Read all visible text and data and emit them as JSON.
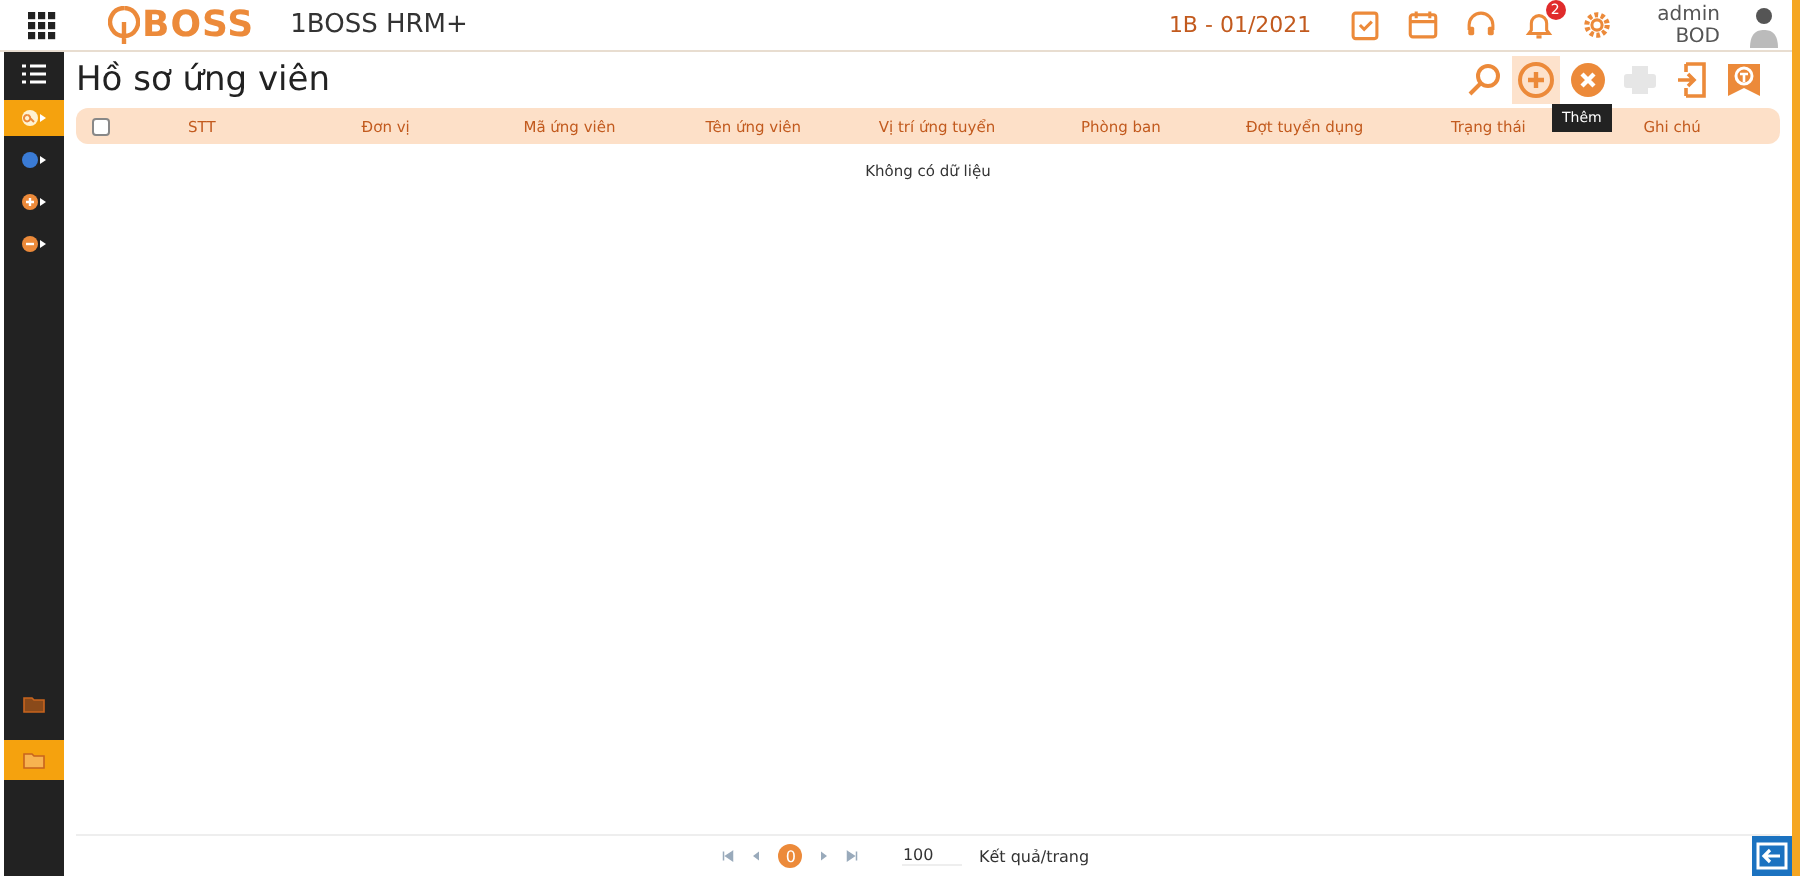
{
  "header": {
    "logo": "BOSS",
    "app_name": "1BOSS HRM+",
    "period": "1B - 01/2021",
    "notification_count": "2",
    "user": {
      "name": "admin",
      "role": "BOD"
    }
  },
  "sidebar": {
    "items": [
      {
        "kind": "search",
        "selected": true
      },
      {
        "kind": "globe",
        "selected": false
      },
      {
        "kind": "plus",
        "selected": false
      },
      {
        "kind": "minus",
        "selected": false
      }
    ],
    "bottom_items": [
      {
        "selected": false
      },
      {
        "selected": true
      }
    ]
  },
  "page": {
    "title": "Hồ sơ ứng viên"
  },
  "toolbar": [
    {
      "kind": "search",
      "disabled": false,
      "hovered": false
    },
    {
      "kind": "add",
      "disabled": false,
      "hovered": true
    },
    {
      "kind": "delete",
      "disabled": false,
      "hovered": false
    },
    {
      "kind": "print",
      "disabled": true,
      "hovered": false
    },
    {
      "kind": "export",
      "disabled": false,
      "hovered": false
    },
    {
      "kind": "filter",
      "disabled": false,
      "hovered": false
    }
  ],
  "tooltip": "Thêm",
  "table": {
    "select_all_checked": false,
    "columns": [
      "STT",
      "Đơn vị",
      "Mã ứng viên",
      "Tên ứng viên",
      "Vị trí ứng tuyển",
      "Phòng ban",
      "Đợt tuyển dụng",
      "Trạng thái",
      "Ghi chú"
    ],
    "empty_message": "Không có dữ liệu"
  },
  "pagination": {
    "current_page": "0",
    "page_size": "100",
    "page_size_label": "Kết quả/trang"
  }
}
